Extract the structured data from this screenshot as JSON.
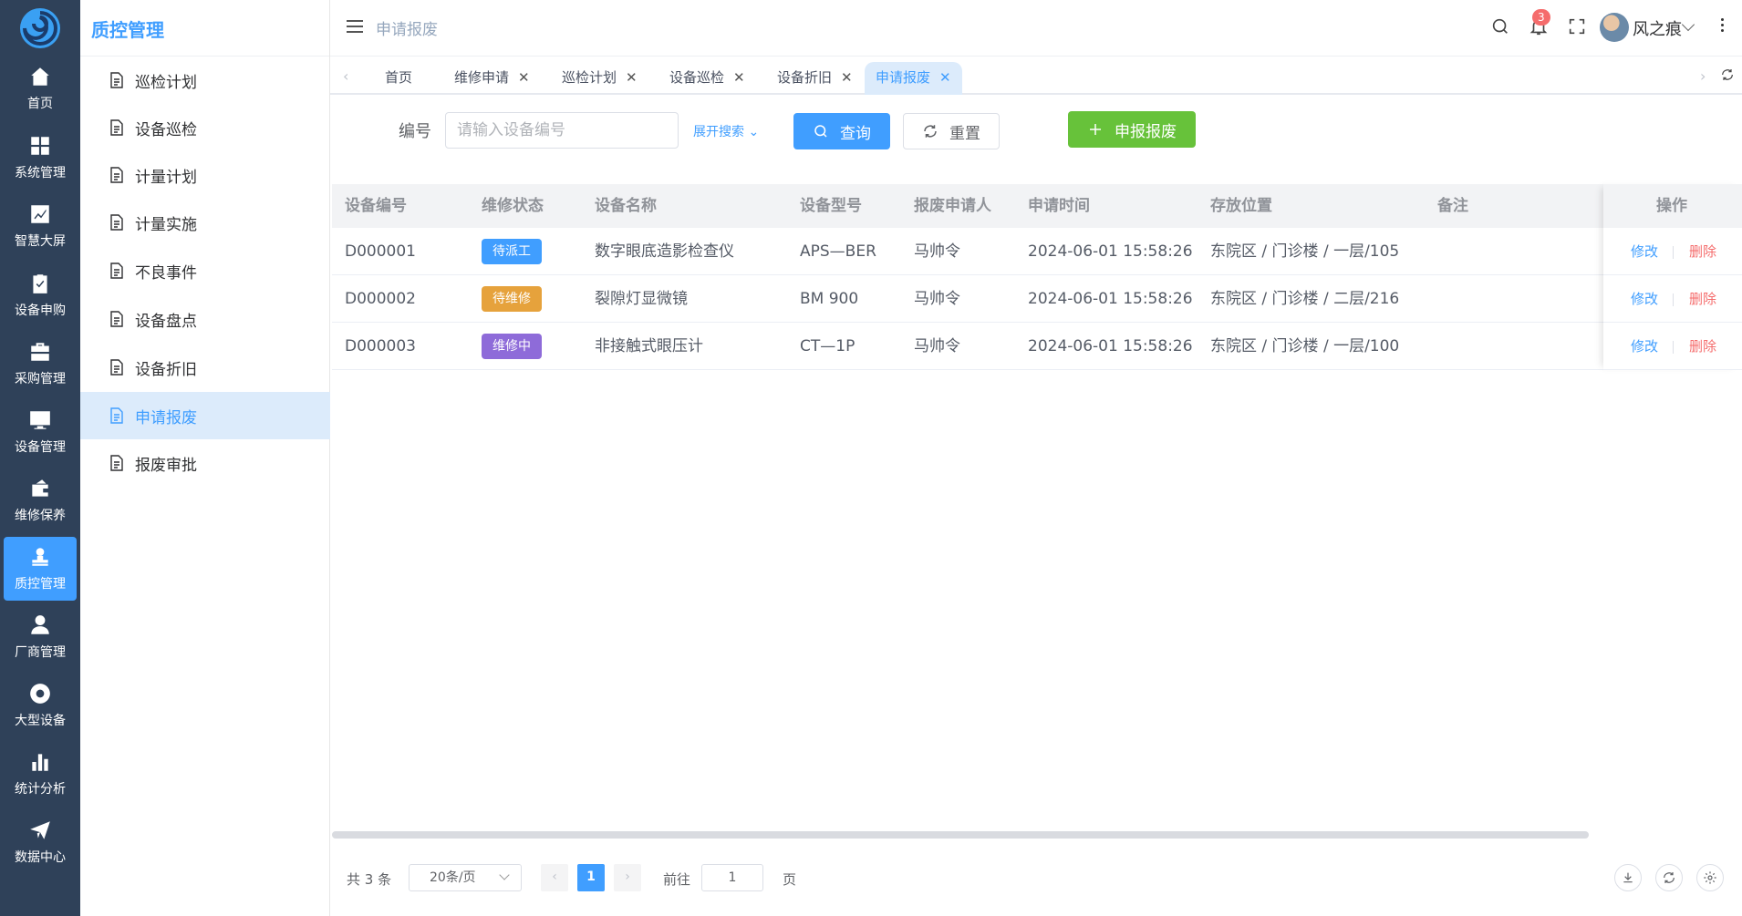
{
  "rail": {
    "items": [
      {
        "label": "首页",
        "icon": "home-icon"
      },
      {
        "label": "系统管理",
        "icon": "grid-icon"
      },
      {
        "label": "智慧大屏",
        "icon": "chart-line-icon"
      },
      {
        "label": "设备申购",
        "icon": "clipboard-check-icon"
      },
      {
        "label": "采购管理",
        "icon": "briefcase-icon"
      },
      {
        "label": "设备管理",
        "icon": "monitor-icon"
      },
      {
        "label": "维修保养",
        "icon": "wallet-icon"
      },
      {
        "label": "质控管理",
        "icon": "user-stamp-icon"
      },
      {
        "label": "厂商管理",
        "icon": "person-icon"
      },
      {
        "label": "大型设备",
        "icon": "chrome-icon"
      },
      {
        "label": "统计分析",
        "icon": "bar-chart-icon"
      },
      {
        "label": "数据中心",
        "icon": "send-icon"
      }
    ],
    "active_index": 7
  },
  "submenu": {
    "title": "质控管理",
    "items": [
      "巡检计划",
      "设备巡检",
      "计量计划",
      "计量实施",
      "不良事件",
      "设备盘点",
      "设备折旧",
      "申请报废",
      "报废审批"
    ],
    "active_index": 7
  },
  "topbar": {
    "breadcrumb": "申请报废",
    "notification_count": "3",
    "username": "风之痕"
  },
  "tabs": [
    {
      "label": "首页",
      "closable": false
    },
    {
      "label": "维修申请",
      "closable": true
    },
    {
      "label": "巡检计划",
      "closable": true
    },
    {
      "label": "设备巡检",
      "closable": true
    },
    {
      "label": "设备折旧",
      "closable": true
    },
    {
      "label": "申请报废",
      "closable": true,
      "active": true
    }
  ],
  "search": {
    "label": "编号",
    "placeholder": "请输入设备编号",
    "value": "",
    "expand_label": "展开搜索",
    "query_label": "查询",
    "reset_label": "重置",
    "add_label": "申报报废"
  },
  "table": {
    "columns": [
      "设备编号",
      "维修状态",
      "设备名称",
      "设备型号",
      "报废申请人",
      "申请时间",
      "存放位置",
      "备注",
      "操作"
    ],
    "rows": [
      {
        "code": "D000001",
        "status": "待派工",
        "status_color": "#409eff",
        "name": "数字眼底造影检查仪",
        "model": "APS—BER",
        "applicant": "马帅令",
        "time": "2024-06-01 15:58:26",
        "location": "东院区 / 门诊楼 / 一层/105",
        "remark": ""
      },
      {
        "code": "D000002",
        "status": "待维修",
        "status_color": "#e6a23c",
        "name": "裂隙灯显微镜",
        "model": "BM 900",
        "applicant": "马帅令",
        "time": "2024-06-01 15:58:26",
        "location": "东院区 / 门诊楼 / 二层/216",
        "remark": ""
      },
      {
        "code": "D000003",
        "status": "维修中",
        "status_color": "#8e6bd9",
        "name": "非接触式眼压计",
        "model": "CT—1P",
        "applicant": "马帅令",
        "time": "2024-06-01 15:58:26",
        "location": "东院区 / 门诊楼 / 一层/100",
        "remark": ""
      }
    ],
    "edit_label": "修改",
    "delete_label": "删除"
  },
  "pagination": {
    "total": "共 3 条",
    "page_size": "20条/页",
    "current_page": "1",
    "goto_label": "前往",
    "goto_value": "1",
    "page_suffix": "页"
  },
  "colors": {
    "primary": "#409eff",
    "success": "#67c23a",
    "danger": "#f56c6c",
    "rail_bg": "#2f4159"
  }
}
